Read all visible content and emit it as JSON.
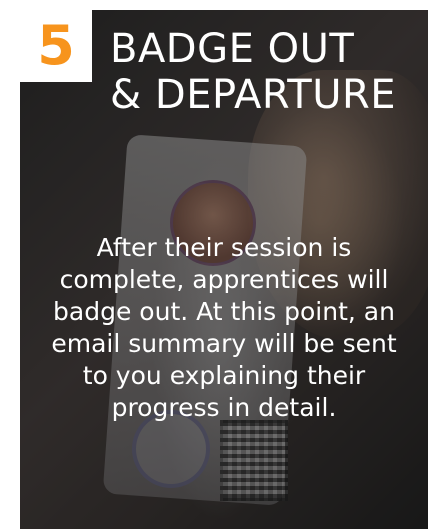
{
  "step": {
    "number": "5",
    "title_line1": "BADGE OUT",
    "title_line2": "& DEPARTURE"
  },
  "description": "After their session is complete, apprentices will badge out. At this point, an email summary will be sent to you explaining their progress in detail.",
  "colors": {
    "accent": "#f7941d",
    "text": "#ffffff",
    "number_box": "#ffffff"
  }
}
